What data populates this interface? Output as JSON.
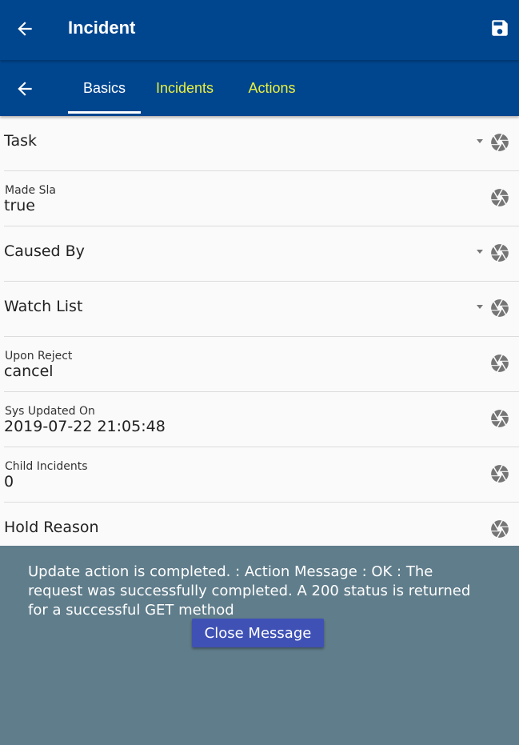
{
  "app": {
    "title": "Incident",
    "back_icon": "arrow-left-icon",
    "save_icon": "floppy-save-icon",
    "bar_color": "#00468f"
  },
  "tabs": {
    "back_icon": "arrow-left-icon",
    "items": [
      {
        "label": "Basics",
        "active": true
      },
      {
        "label": "Incidents",
        "active": false
      },
      {
        "label": "Actions",
        "active": false
      }
    ],
    "active_color": "#ffffff",
    "inactive_color": "#e8f040"
  },
  "fields": [
    {
      "label": "Task",
      "dropdown": true
    },
    {
      "label": "Made Sla",
      "value": "true"
    },
    {
      "label": "Caused By",
      "dropdown": true
    },
    {
      "label": "Watch List",
      "dropdown": true
    },
    {
      "label": "Upon Reject",
      "value": "cancel"
    },
    {
      "label": "Sys Updated On",
      "value": "2019-07-22 21:05:48"
    },
    {
      "label": "Child Incidents",
      "value": "0"
    },
    {
      "label": "Hold Reason"
    }
  ],
  "field_icon": "camera-aperture-icon",
  "dropdown_icon": "caret-down-icon",
  "message": {
    "text": "Update action is completed.  : Action Message : OK : The request was successfully completed. A 200 status is returned for a successful GET method",
    "close_label": "Close Message",
    "background": "#607d8b",
    "button_color": "#3f51b5"
  }
}
